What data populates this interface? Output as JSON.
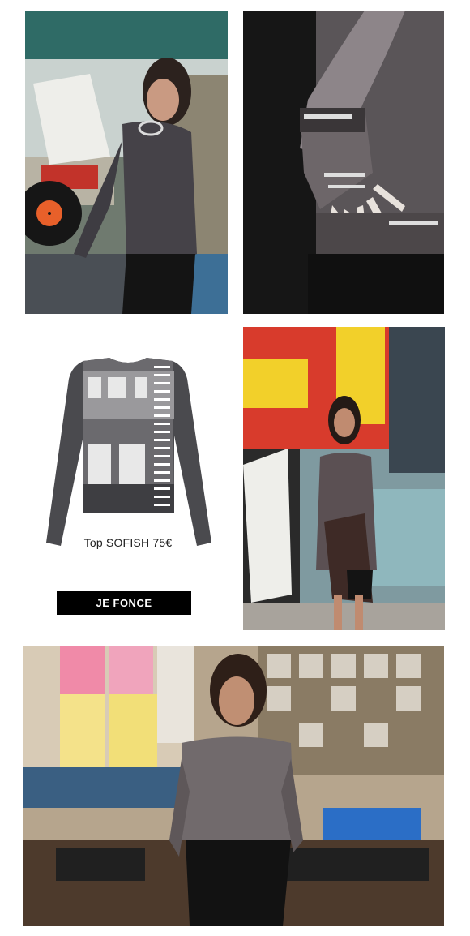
{
  "product": {
    "caption": "Top SOFISH 75€",
    "cta_label": "JE FONCE"
  },
  "images": {
    "record_store_vinyl": {
      "name": "model-browsing-vinyl-records-photo"
    },
    "sleeve_closeup": {
      "name": "printed-mesh-sleeve-closeup-photo"
    },
    "product_shot": {
      "name": "sofish-top-product-photo"
    },
    "street_poster_wall": {
      "name": "model-in-front-of-poster-wall-photo"
    },
    "record_store_wide": {
      "name": "model-in-record-store-photo"
    }
  },
  "colors": {
    "cta_background": "#000000",
    "cta_text": "#ffffff",
    "caption_text": "#222222"
  }
}
